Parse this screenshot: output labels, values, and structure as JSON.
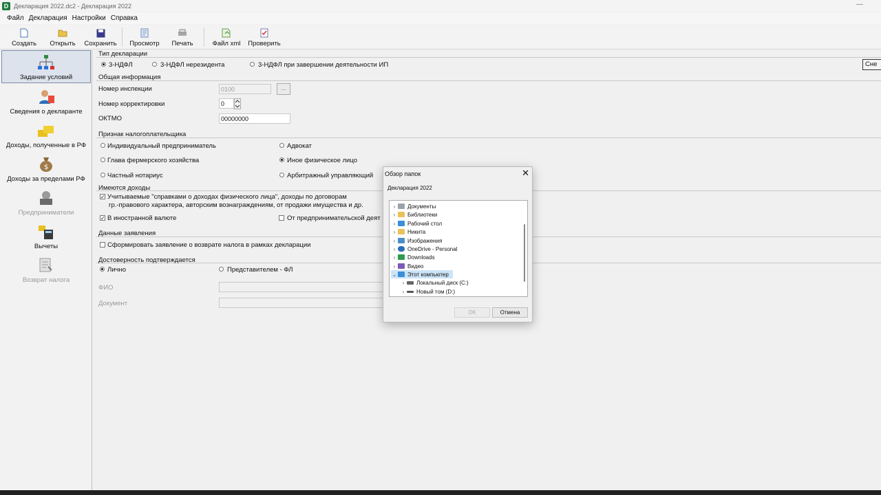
{
  "window": {
    "title": "Декларация 2022.dc2 - Декларация 2022",
    "app_icon_letter": "D",
    "minimize_glyph": "—"
  },
  "menu": [
    "Файл",
    "Декларация",
    "Настройки",
    "Справка"
  ],
  "toolbar": {
    "create": "Создать",
    "open": "Открыть",
    "save": "Сохранить",
    "preview": "Просмотр",
    "print": "Печать",
    "xml_file": "Файл xml",
    "check": "Проверить"
  },
  "sidebar": {
    "items": [
      {
        "label": "Задание условий"
      },
      {
        "label": "Сведения о декларанте"
      },
      {
        "label": "Доходы, полученные в РФ"
      },
      {
        "label": "Доходы за пределами РФ"
      },
      {
        "label": "Предприниматели"
      },
      {
        "label": "Вычеты"
      },
      {
        "label": "Возврат налога"
      }
    ]
  },
  "declaration_type": {
    "title": "Тип декларации",
    "options": [
      "3-НДФЛ",
      "3-НДФЛ нерезидента",
      "3-НДФЛ при завершении деятельности ИП"
    ],
    "side_button": "Сне"
  },
  "general": {
    "title": "Общая информация",
    "inspection_label": "Номер инспекции",
    "inspection_value": "0100",
    "inspection_browse": "...",
    "correction_label": "Номер корректировки",
    "correction_value": "0",
    "oktmo_label": "ОКТМО",
    "oktmo_value": "00000000"
  },
  "taxpayer": {
    "title": "Признак налогоплательщика",
    "options": [
      "Индивидуальный предприниматель",
      "Адвокат",
      "Глава фермерского хозяйства",
      "Иное физическое лицо",
      "Частный нотариус",
      "Арбитражный управляющий"
    ]
  },
  "income": {
    "title": "Имеются доходы",
    "certified_line1": "Учитываемые \"справками о доходах физического лица\", доходы по договорам",
    "certified_line2": "гр.-правового характера, авторским вознаграждениям, от продажи имущества и др.",
    "foreign_currency": "В иностранной валюте",
    "business": "От предпринимательской деят"
  },
  "application": {
    "title": "Данные заявления",
    "refund": "Сформировать заявление о возврате налога в рамках декларации"
  },
  "reliability": {
    "title": "Достоверность подтверждается",
    "personally": "Лично",
    "representative": "Представителем - ФЛ",
    "fio_label": "ФИО",
    "document_label": "Документ"
  },
  "dialog": {
    "title": "Обзор папок",
    "description": "Декларация 2022",
    "tree": [
      {
        "label": "Документы",
        "color": "#9aa3ad"
      },
      {
        "label": "Библиотеки",
        "color": "#e8c35a"
      },
      {
        "label": "Рабочий стол",
        "color": "#3a8fd8"
      },
      {
        "label": "Никита",
        "color": "#e8c35a"
      },
      {
        "label": "Изображения",
        "color": "#4a90c8"
      },
      {
        "label": "OneDrive - Personal",
        "color": "#2a6fb8"
      },
      {
        "label": "Downloads",
        "color": "#2e9b4e"
      },
      {
        "label": "Видео",
        "color": "#7a5ab8"
      },
      {
        "label": "Этот компьютер",
        "color": "#3a8fd8"
      },
      {
        "label": "Локальный диск (C:)",
        "color": "#666666"
      },
      {
        "label": "Новый том (D:)",
        "color": "#555555"
      }
    ],
    "ok": "OK",
    "cancel": "Отмена"
  }
}
